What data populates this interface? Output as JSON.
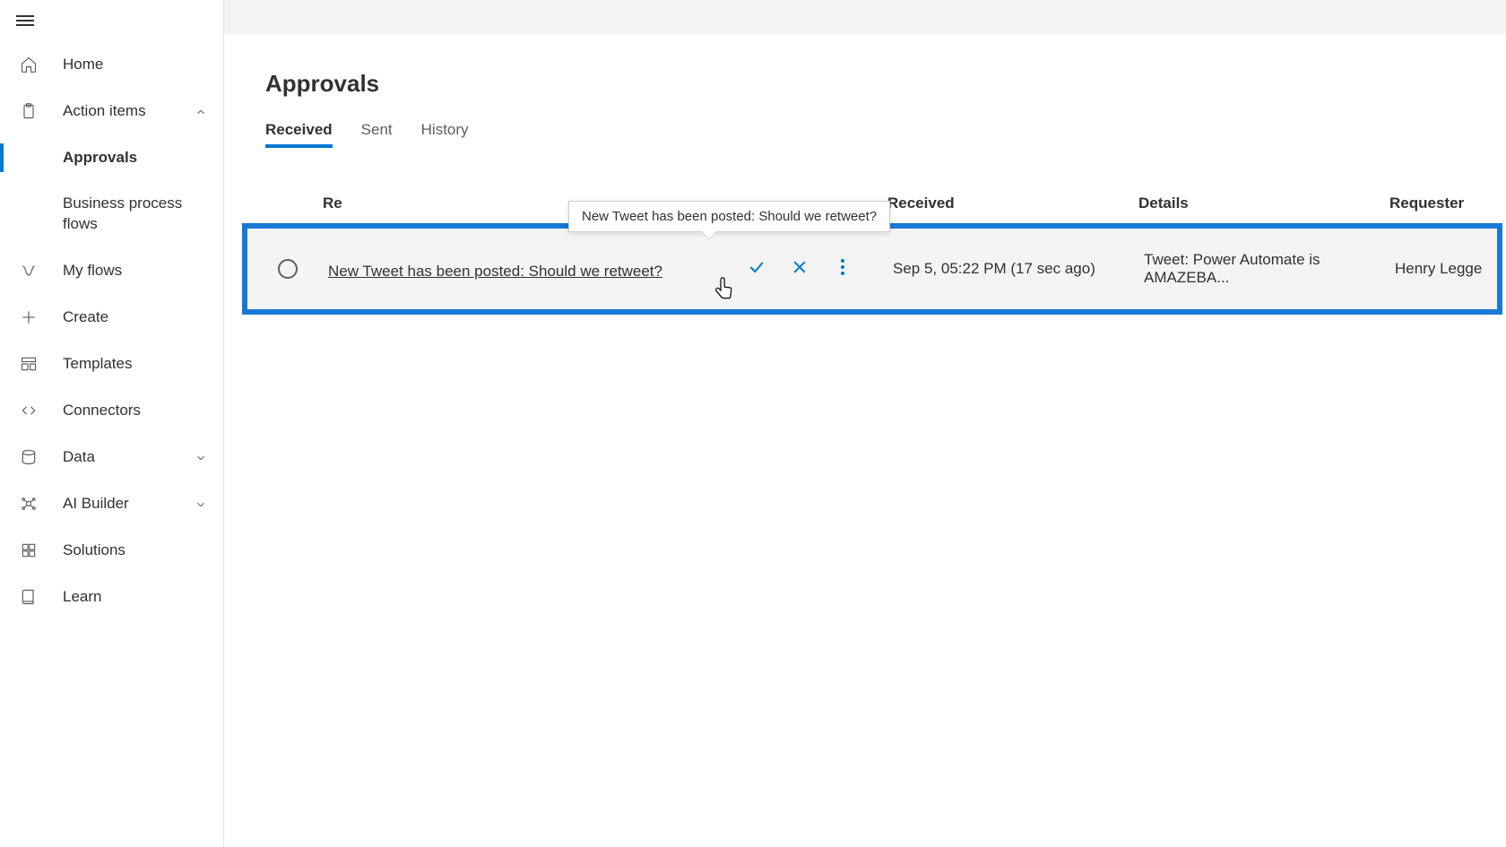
{
  "sidebar": {
    "home": "Home",
    "action_items": "Action items",
    "approvals": "Approvals",
    "bpf": "Business process flows",
    "my_flows": "My flows",
    "create": "Create",
    "templates": "Templates",
    "connectors": "Connectors",
    "data": "Data",
    "ai_builder": "AI Builder",
    "solutions": "Solutions",
    "learn": "Learn"
  },
  "page": {
    "title": "Approvals"
  },
  "tabs": {
    "received": "Received",
    "sent": "Sent",
    "history": "History"
  },
  "columns": {
    "request": "Request",
    "received": "Received",
    "details": "Details",
    "requester": "Requester"
  },
  "columns_visible": {
    "request_truncated": "Re"
  },
  "tooltip": "New Tweet has been posted: Should we retweet?",
  "row": {
    "request": "New Tweet has been posted: Should we retweet?",
    "received": "Sep 5, 05:22 PM (17 sec ago)",
    "details": "Tweet: Power Automate is AMAZEBA...",
    "requester": "Henry Legge"
  }
}
